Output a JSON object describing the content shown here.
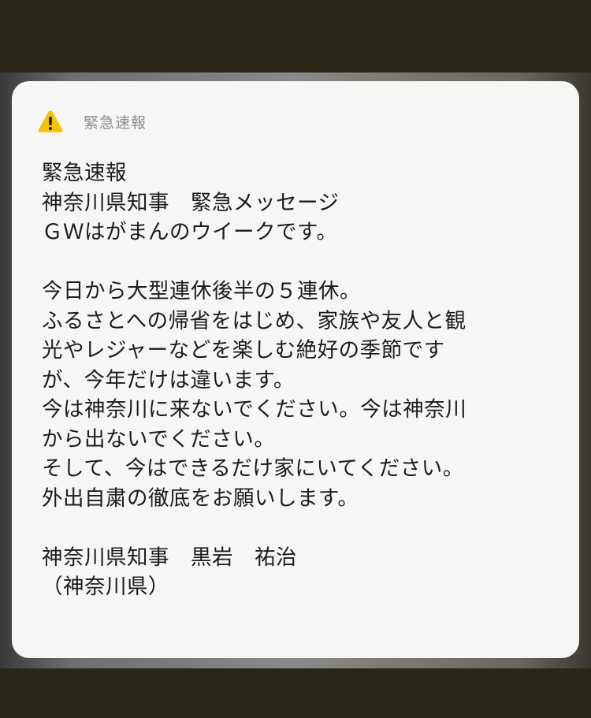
{
  "notification": {
    "icon": "warning-triangle-icon",
    "accent_color": "#f5c400",
    "app_name": "緊急速報",
    "message_lines": [
      "緊急速報",
      "神奈川県知事　緊急メッセージ",
      "ＧＷはがまんのウイークです。",
      "",
      "今日から大型連休後半の５連休。",
      "ふるさとへの帰省をはじめ、家族や友人と観",
      "光やレジャーなどを楽しむ絶好の季節です",
      "が、今年だけは違います。",
      "今は神奈川に来ないでください。今は神奈川",
      "から出ないでください。",
      "そして、今はできるだけ家にいてください。",
      "外出自粛の徹底をお願いします。",
      "",
      "神奈川県知事　黒岩　祐治",
      "（神奈川県）"
    ]
  }
}
